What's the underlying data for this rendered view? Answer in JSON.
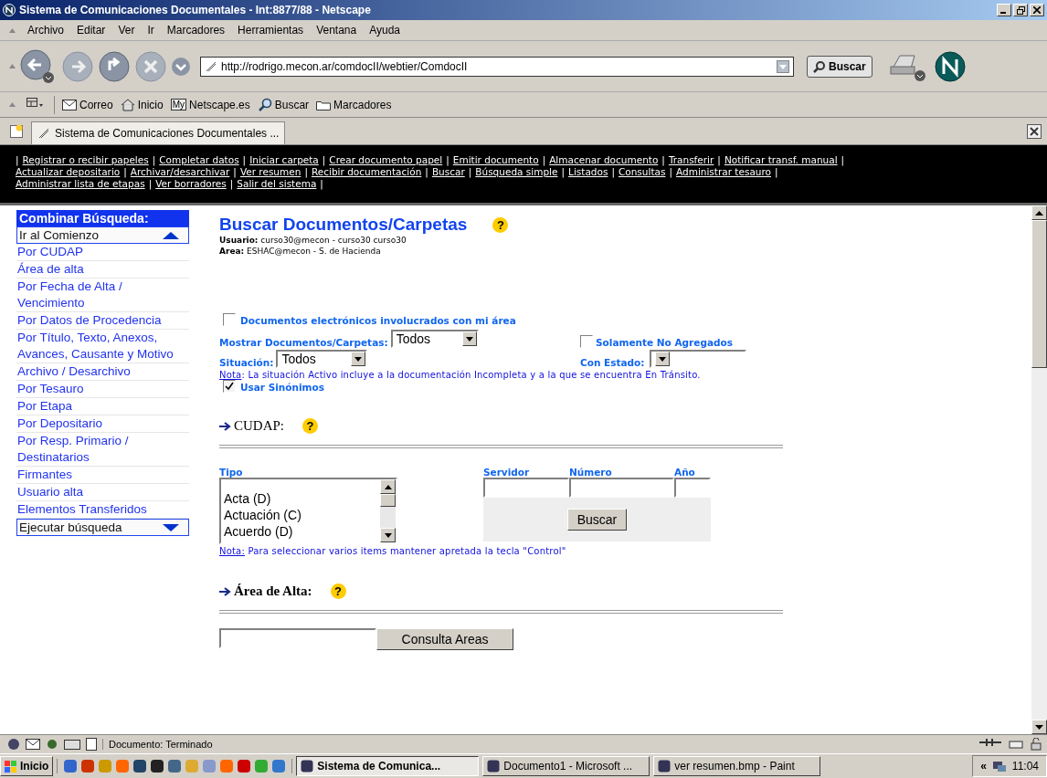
{
  "window": {
    "title": "Sistema de Comunicaciones Documentales - Int:8877/88 - Netscape"
  },
  "menu": [
    "Archivo",
    "Editar",
    "Ver",
    "Ir",
    "Marcadores",
    "Herramientas",
    "Ventana",
    "Ayuda"
  ],
  "nav_toolbar": {
    "url": "http://rodrigo.mecon.ar/comdocII/webtier/ComdocII",
    "search_button": "Buscar"
  },
  "personal_toolbar": [
    {
      "kind": "mail",
      "label": "Correo"
    },
    {
      "kind": "home",
      "label": "Inicio"
    },
    {
      "kind": "my",
      "badge": "My",
      "label": "Netscape.es"
    },
    {
      "kind": "search",
      "label": "Buscar"
    },
    {
      "kind": "folder",
      "label": "Marcadores"
    }
  ],
  "tabs": [
    {
      "label": "Sistema de Comunicaciones Documentales ...",
      "selected": true
    }
  ],
  "page": {
    "nav_separator": "|",
    "nav_lines": [
      [
        "Registrar o recibir papeles",
        "Completar datos",
        "Iniciar carpeta",
        "Crear documento papel",
        "Emitir documento",
        "Almacenar documento",
        "Transferir",
        "Notificar transf. manual"
      ],
      [
        "Actualizar depositario",
        "Archivar/desarchivar",
        "Ver resumen",
        "Recibir documentación",
        "Buscar",
        "Búsqueda simple",
        "Listados",
        "Consultas",
        "Administrar tesauro"
      ],
      [
        "Administrar lista de etapas",
        "Ver borradores",
        "Salir del sistema"
      ]
    ],
    "sidebar": {
      "header": "Combinar Búsqueda:",
      "top_button": "Ir al Comienzo",
      "items": [
        "Por CUDAP",
        "Área de alta",
        "Por Fecha de Alta / Vencimiento",
        "Por Datos de Procedencia",
        "Por Título, Texto, Anexos, Avances, Causante y Motivo",
        "Archivo / Desarchivo",
        "Por Tesauro",
        "Por Etapa",
        "Por Depositario",
        "Por Resp. Primario / Destinatarios",
        "Firmantes",
        "Usuario alta",
        "Elementos Transferidos"
      ],
      "bottom_button": "Ejecutar búsqueda"
    },
    "title": "Buscar Documentos/Carpetas",
    "help": "?",
    "user_label": "Usuario:",
    "user": "curso30@mecon - curso30 curso30",
    "area_label": "Area:",
    "area": "ESHAC@mecon - S. de Hacienda",
    "electronic_docs": {
      "label": "Documentos electrónicos involucrados con mi área",
      "checked": false
    },
    "show_label": "Mostrar Documentos/Carpetas:",
    "show_value": "Todos",
    "not_added": {
      "label": "Solamente No Agregados",
      "checked": false
    },
    "situation_label": "Situación:",
    "situation_value": "Todos",
    "state_label": "Con Estado:",
    "note_link": "Nota",
    "note_text": ": La situación Activo incluye a la documentación Incompleta y a la que se encuentra En Tránsito.",
    "synonyms": {
      "label": "Usar Sinónimos",
      "checked": true
    },
    "cudap": {
      "heading": "CUDAP:",
      "help": "?",
      "type_label": "Tipo",
      "types": [
        "Acta (D)",
        "Actuación (C)",
        "Acuerdo (D)"
      ],
      "server_label": "Servidor",
      "number_label": "Número",
      "year_label": "Año",
      "search_button": "Buscar",
      "note_link": "Nota:",
      "note_text": " Para seleccionar varios items mantener apretada la tecla \"Control\""
    },
    "area_alta": {
      "heading": "Área de Alta:",
      "help": "?",
      "button": "Consulta Areas"
    }
  },
  "status_bar": {
    "text": "Documento: Terminado"
  },
  "taskbar": {
    "start": "Inicio",
    "tasks": [
      {
        "label": "Sistema de Comunica...",
        "selected": true
      },
      {
        "label": "Documento1 - Microsoft ...",
        "selected": false
      },
      {
        "label": "ver resumen.bmp - Paint",
        "selected": false
      }
    ],
    "chevron": "«",
    "clock": "11:04"
  }
}
